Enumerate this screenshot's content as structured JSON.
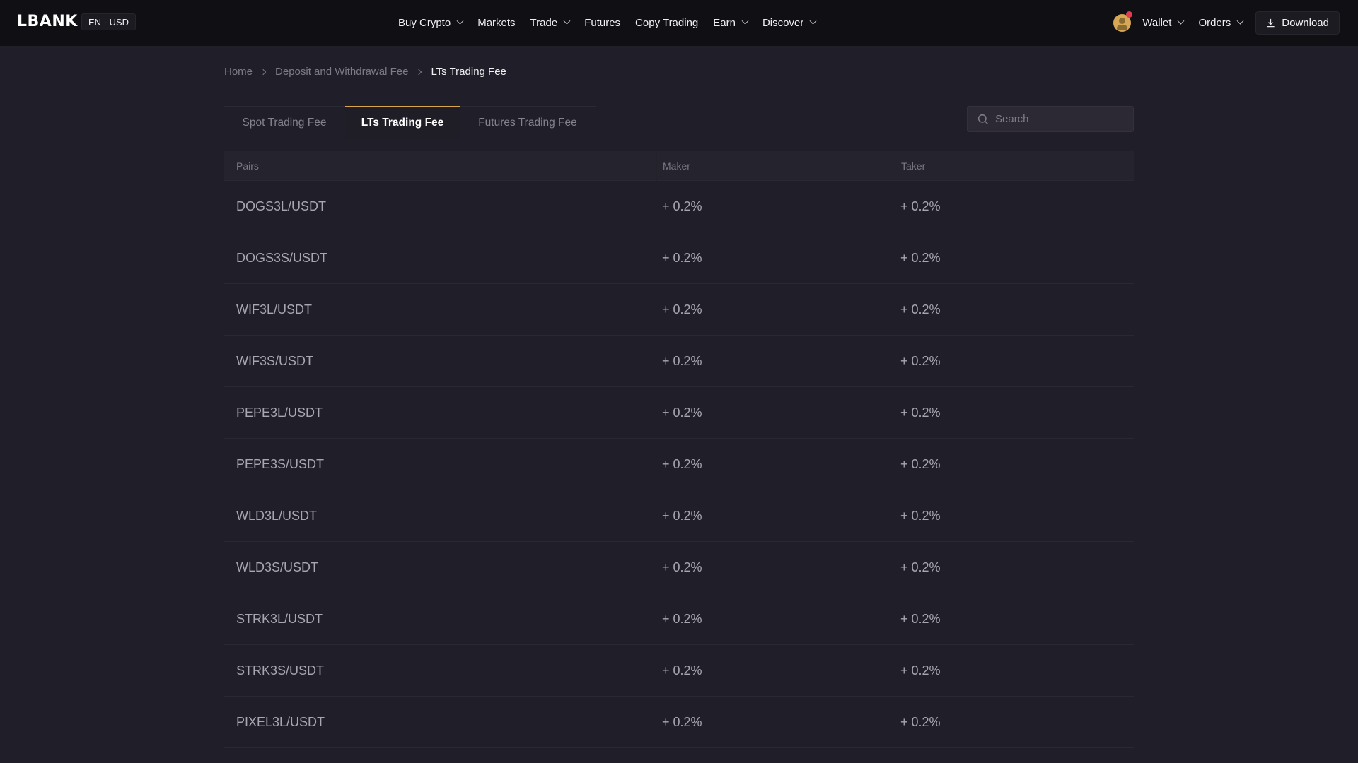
{
  "header": {
    "logo": "LBANK",
    "lang_currency": "EN - USD",
    "nav": [
      {
        "label": "Buy Crypto",
        "has_dropdown": true
      },
      {
        "label": "Markets",
        "has_dropdown": false
      },
      {
        "label": "Trade",
        "has_dropdown": true
      },
      {
        "label": "Futures",
        "has_dropdown": false
      },
      {
        "label": "Copy Trading",
        "has_dropdown": false
      },
      {
        "label": "Earn",
        "has_dropdown": true
      },
      {
        "label": "Discover",
        "has_dropdown": true
      }
    ],
    "wallet_label": "Wallet",
    "orders_label": "Orders",
    "download_label": "Download",
    "notification_dot_color": "#e23d4f",
    "avatar_color": "#d6a754"
  },
  "breadcrumb": [
    {
      "label": "Home"
    },
    {
      "label": "Deposit and Withdrawal Fee"
    },
    {
      "label": "LTs Trading Fee",
      "current": true
    }
  ],
  "tabs": [
    {
      "label": "Spot Trading Fee",
      "active": false
    },
    {
      "label": "LTs Trading Fee",
      "active": true
    },
    {
      "label": "Futures Trading Fee",
      "active": false
    }
  ],
  "accent_color": "#d9a64a",
  "search": {
    "placeholder": "Search",
    "value": ""
  },
  "table": {
    "columns": [
      "Pairs",
      "Maker",
      "Taker"
    ],
    "rows": [
      {
        "pair": "DOGS3L/USDT",
        "maker": "+ 0.2%",
        "taker": "+ 0.2%"
      },
      {
        "pair": "DOGS3S/USDT",
        "maker": "+ 0.2%",
        "taker": "+ 0.2%"
      },
      {
        "pair": "WIF3L/USDT",
        "maker": "+ 0.2%",
        "taker": "+ 0.2%"
      },
      {
        "pair": "WIF3S/USDT",
        "maker": "+ 0.2%",
        "taker": "+ 0.2%"
      },
      {
        "pair": "PEPE3L/USDT",
        "maker": "+ 0.2%",
        "taker": "+ 0.2%"
      },
      {
        "pair": "PEPE3S/USDT",
        "maker": "+ 0.2%",
        "taker": "+ 0.2%"
      },
      {
        "pair": "WLD3L/USDT",
        "maker": "+ 0.2%",
        "taker": "+ 0.2%"
      },
      {
        "pair": "WLD3S/USDT",
        "maker": "+ 0.2%",
        "taker": "+ 0.2%"
      },
      {
        "pair": "STRK3L/USDT",
        "maker": "+ 0.2%",
        "taker": "+ 0.2%"
      },
      {
        "pair": "STRK3S/USDT",
        "maker": "+ 0.2%",
        "taker": "+ 0.2%"
      },
      {
        "pair": "PIXEL3L/USDT",
        "maker": "+ 0.2%",
        "taker": "+ 0.2%"
      }
    ]
  }
}
